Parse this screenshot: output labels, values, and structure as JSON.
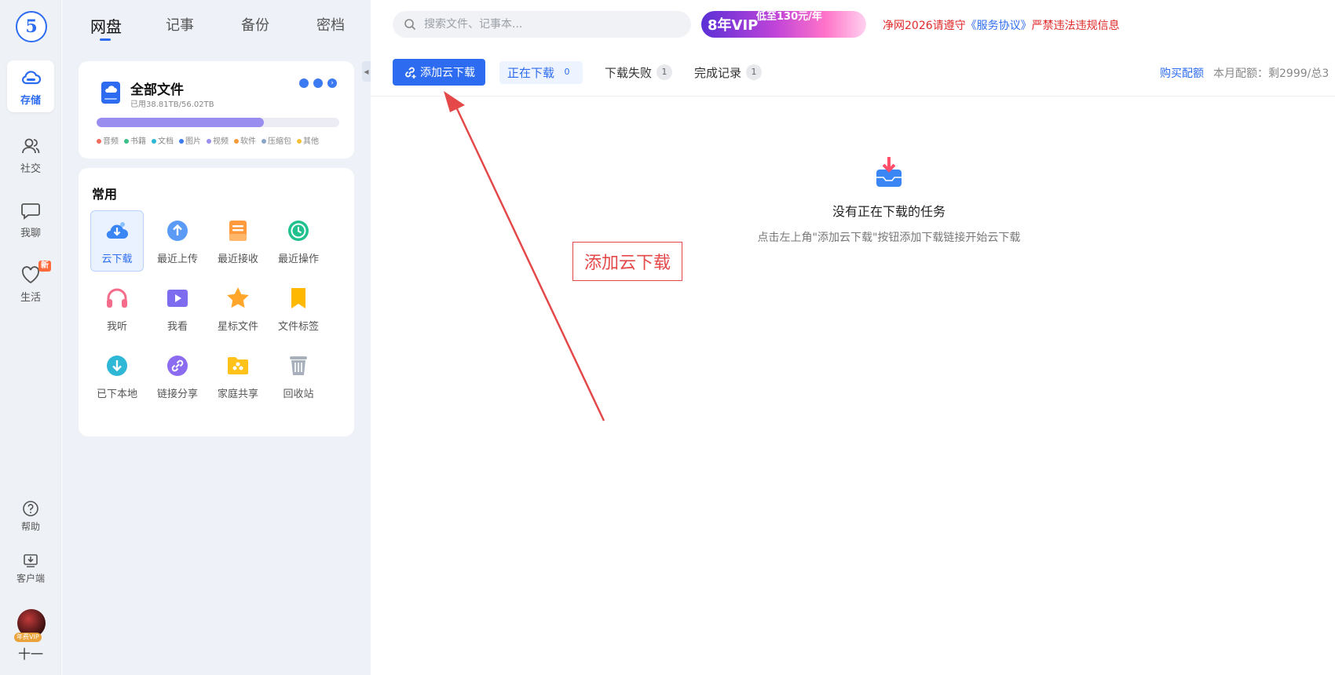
{
  "rail": {
    "logo": "5",
    "items": [
      {
        "label": "存储",
        "icon": "cloud-icon"
      },
      {
        "label": "社交",
        "icon": "users-icon"
      },
      {
        "label": "我聊",
        "icon": "chat-icon"
      },
      {
        "label": "生活",
        "icon": "heart-icon",
        "badge": "新"
      }
    ],
    "help": {
      "label": "帮助",
      "icon": "help-icon"
    },
    "client": {
      "label": "客户端",
      "icon": "download-client-icon"
    },
    "user": {
      "badge": "年费VIP",
      "name": "十一"
    }
  },
  "panel": {
    "tabs": [
      "网盘",
      "记事",
      "备份",
      "密档"
    ],
    "storage": {
      "title": "全部文件",
      "usage": "已用38.81TB/56.02TB",
      "used_fraction": 0.69,
      "legend": [
        {
          "label": "音频",
          "color": "#f26b5b"
        },
        {
          "label": "书籍",
          "color": "#3cc08a"
        },
        {
          "label": "文档",
          "color": "#2fb7d6"
        },
        {
          "label": "图片",
          "color": "#3b7af0"
        },
        {
          "label": "视频",
          "color": "#9a8df0"
        },
        {
          "label": "软件",
          "color": "#f59a3a"
        },
        {
          "label": "压缩包",
          "color": "#8aa4c8"
        },
        {
          "label": "其他",
          "color": "#f5c13a"
        }
      ]
    },
    "common": {
      "title": "常用",
      "items": [
        {
          "label": "云下载",
          "icon": "cloud-download-icon"
        },
        {
          "label": "最近上传",
          "icon": "upload-icon"
        },
        {
          "label": "最近接收",
          "icon": "inbox-icon"
        },
        {
          "label": "最近操作",
          "icon": "history-icon"
        },
        {
          "label": "我听",
          "icon": "headphones-icon"
        },
        {
          "label": "我看",
          "icon": "play-icon"
        },
        {
          "label": "星标文件",
          "icon": "star-icon"
        },
        {
          "label": "文件标签",
          "icon": "bookmark-icon"
        },
        {
          "label": "已下本地",
          "icon": "downloaded-icon"
        },
        {
          "label": "链接分享",
          "icon": "link-icon"
        },
        {
          "label": "家庭共享",
          "icon": "family-folder-icon"
        },
        {
          "label": "回收站",
          "icon": "trash-icon"
        }
      ]
    }
  },
  "header": {
    "search_placeholder": "搜索文件、记事本...",
    "vip_banner": "8年VIP",
    "vip_banner_sub": "低至130元/年",
    "notice_prefix": "净网2026请遵守",
    "notice_link": "《服务协议》",
    "notice_suffix": "严禁违法违规信息"
  },
  "toolbar": {
    "add_button": "添加云下载",
    "tabs": [
      {
        "label": "正在下载",
        "count": "0"
      },
      {
        "label": "下载失败",
        "count": "1"
      },
      {
        "label": "完成记录",
        "count": "1"
      }
    ],
    "buy_quota": "购买配额",
    "quota_text": "本月配额：剩2999/总3"
  },
  "empty": {
    "title": "没有正在下载的任务",
    "subtitle": "点击左上角\"添加云下载\"按钮添加下载链接开始云下载"
  },
  "annotation": {
    "label": "添加云下载"
  },
  "colors": {
    "accent": "#2d6cf0",
    "annotation": "#e54848",
    "notice": "#e12a2a"
  }
}
